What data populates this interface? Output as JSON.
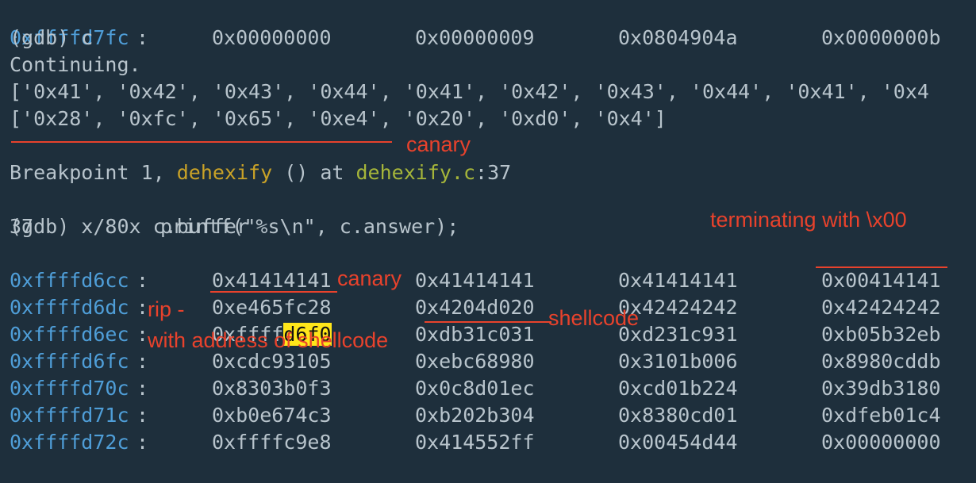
{
  "terminal": {
    "top_row": {
      "addr": "0xffffd7fc",
      "colon": ":",
      "w1": "0x00000000",
      "w2": "0x00000009",
      "w3": "0x0804904a",
      "w4": "0x0000000b"
    },
    "cmd_continue": "(gdb) c",
    "continuing": "Continuing.",
    "list1": "['0x41', '0x42', '0x43', '0x44', '0x41', '0x42', '0x43', '0x44', '0x41', '0x4",
    "list2": "['0x28', '0xfc', '0x65', '0xe4', '0x20', '0xd0', '0x4']",
    "breakpoint": {
      "prefix": "Breakpoint 1, ",
      "func": "dehexify",
      "mid": " () at ",
      "file": "dehexify.c",
      "line": ":37"
    },
    "source_line": {
      "num": "37",
      "code": "printf(\"%s\\n\", c.answer);"
    },
    "cmd_examine": "(gdb) x/80x c.buffer",
    "memory_rows": [
      {
        "addr": "0xffffd6cc",
        "colon": ":",
        "w1": "0x41414141",
        "w2": "0x41414141",
        "w3": "0x41414141",
        "w4": "0x00414141"
      },
      {
        "addr": "0xffffd6dc",
        "colon": ":",
        "w1": "0xe465fc28",
        "w2": "0x4204d020",
        "w3": "0x42424242",
        "w4": "0x42424242"
      },
      {
        "addr": "0xffffd6ec",
        "colon": ":",
        "w1a": "0xffff",
        "w1b": "d6f0",
        "w2": "0xdb31c031",
        "w3": "0xd231c931",
        "w4": "0xb05b32eb"
      },
      {
        "addr": "0xffffd6fc",
        "colon": ":",
        "w1": "0xcdc93105",
        "w2": "0xebc68980",
        "w3": "0x3101b006",
        "w4": "0x8980cddb"
      },
      {
        "addr": "0xffffd70c",
        "colon": ":",
        "w1": "0x8303b0f3",
        "w2": "0x0c8d01ec",
        "w3": "0xcd01b224",
        "w4": "0x39db3180"
      },
      {
        "addr": "0xffffd71c",
        "colon": ":",
        "w1": "0xb0e674c3",
        "w2": "0xb202b304",
        "w3": "0x8380cd01",
        "w4": "0xdfeb01c4"
      },
      {
        "addr": "0xffffd72c",
        "colon": ":",
        "w1": "0xffffc9e8",
        "w2": "0x414552ff",
        "w3": "0x00454d44",
        "w4": "0x00000000"
      }
    ]
  },
  "annotations": {
    "canary1": "canary",
    "terminating": "terminating with \\x00",
    "canary2": "canary",
    "rip": "rip -",
    "rip_detail": "with address of shellcode",
    "shellcode": "shellcode"
  },
  "colors": {
    "background": "#1e2f3c",
    "text": "#b8c4cc",
    "address": "#4f9ed8",
    "annotation": "#e8422c",
    "highlight": "#ffe61a"
  }
}
